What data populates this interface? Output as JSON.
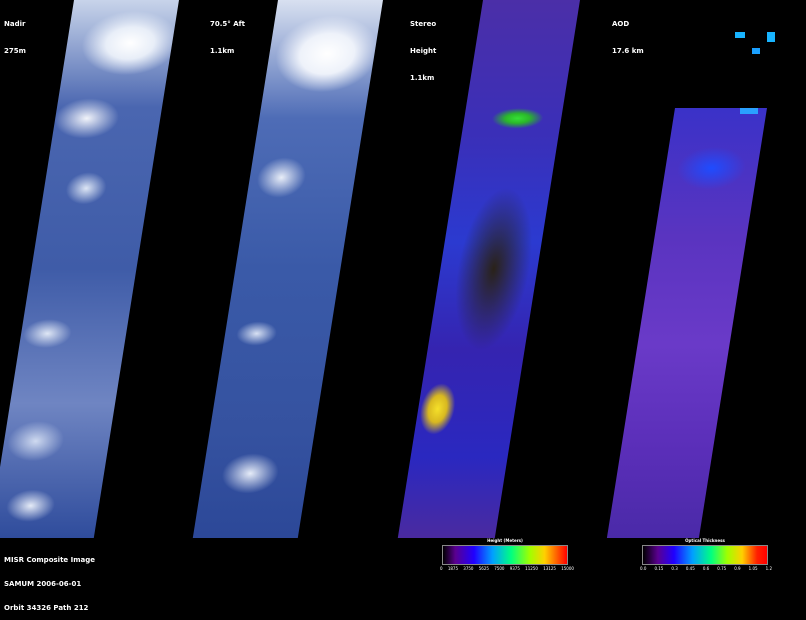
{
  "panels": [
    {
      "line1": "Nadir",
      "line2": "275m",
      "line3": ""
    },
    {
      "line1": "70.5° Aft",
      "line2": "1.1km",
      "line3": ""
    },
    {
      "line1": "Stereo",
      "line2": "Height",
      "line3": "1.1km"
    },
    {
      "line1": "AOD",
      "line2": "17.6 km",
      "line3": ""
    }
  ],
  "caption": {
    "line1": "MISR Composite Image",
    "line2": "SAMUM 2006-06-01",
    "line3": "Orbit 34326 Path 212"
  },
  "height_scale": {
    "title": "Height (Meters)",
    "ticks": [
      "0",
      "1875",
      "3750",
      "5625",
      "7500",
      "9375",
      "11250",
      "13125",
      "15000"
    ]
  },
  "aod_scale": {
    "title": "Optical Thickness",
    "ticks": [
      "0.0",
      "0.15",
      "0.3",
      "0.45",
      "0.6",
      "0.75",
      "0.9",
      "1.05",
      "1.2"
    ]
  }
}
